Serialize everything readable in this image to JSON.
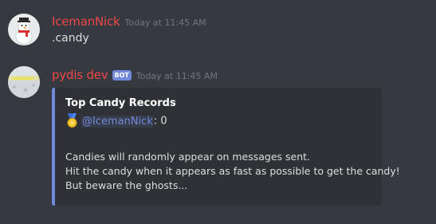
{
  "messages": [
    {
      "author": "IcemanNick",
      "timestamp": "Today at 11:45 AM",
      "content": ".candy",
      "avatar_icon": "snowman-avatar"
    },
    {
      "author": "pydis dev",
      "badge": "BOT",
      "timestamp": "Today at 11:45 AM",
      "avatar_icon": "snowy-landscape-avatar",
      "embed": {
        "accent_color": "#7289da",
        "title": "Top Candy Records",
        "field": {
          "icon": "gold-medal-icon",
          "mention": "@IcemanNick",
          "score": ": 0"
        },
        "description": [
          "Candies will randomly appear on messages sent.",
          "Hit the candy when it appears as fast as possible to get the candy!",
          "But beware the ghosts..."
        ]
      }
    }
  ],
  "colors": {
    "background": "#36393f",
    "embed_background": "#2f3136",
    "username": "#f04747",
    "mention": "#7289da",
    "timestamp": "#72767d",
    "text": "#dcddde"
  }
}
